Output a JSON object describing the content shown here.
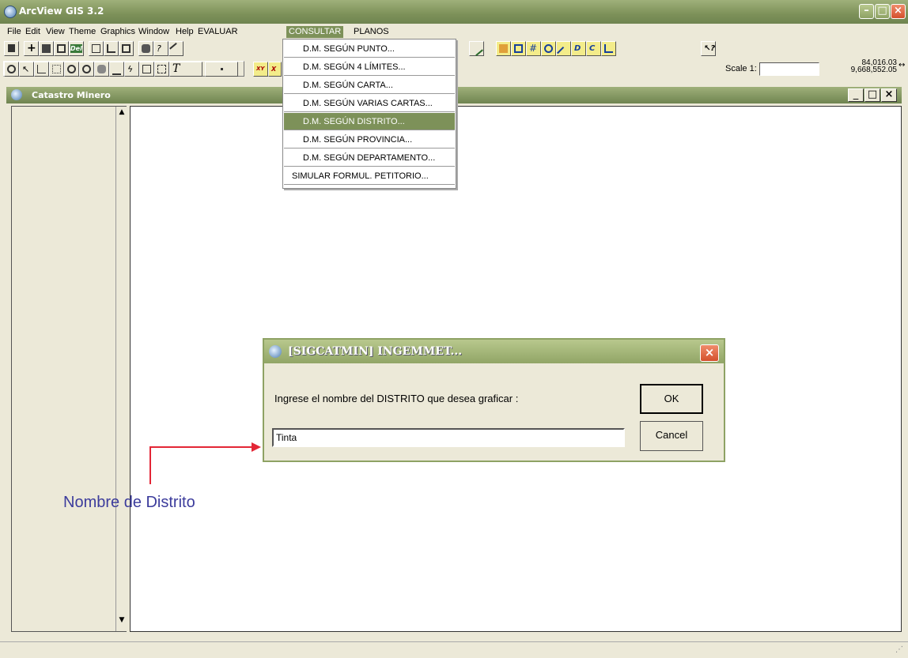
{
  "app": {
    "title": "ArcView GIS 3.2"
  },
  "menu": [
    "File",
    "Edit",
    "View",
    "Theme",
    "Graphics",
    "Window",
    "Help",
    "EVALUAR",
    "CONSULTAR",
    "PLANOS"
  ],
  "scale": {
    "label": "Scale 1:",
    "value": ""
  },
  "coords": {
    "x": "84,016.03",
    "y": "9,668,552.05"
  },
  "dropdown": {
    "items": [
      "D.M. SEGÚN PUNTO...",
      "D.M. SEGÚN 4 LÍMITES...",
      "D.M. SEGÚN CARTA...",
      "D.M. SEGÚN VARIAS CARTAS...",
      "D.M. SEGÚN DISTRITO...",
      "D.M. SEGÚN PROVINCIA...",
      "D.M. SEGÚN DEPARTAMENTO...",
      "SIMULAR FORMUL. PETITORIO..."
    ],
    "highlighted_index": 4
  },
  "view": {
    "title": "Catastro Minero"
  },
  "dialog": {
    "title": "[SIGCATMIN] INGEMMET...",
    "prompt": "Ingrese el nombre del DISTRITO que desea graficar :",
    "input_value": "Tinta",
    "ok_label": "OK",
    "cancel_label": "Cancel"
  },
  "annotation": {
    "text": "Nombre de Distrito",
    "arrow_color": "#e32636"
  },
  "colors": {
    "title_bar": "#7d9159",
    "menu_highlight": "#7d9159",
    "annotation_text": "#3c3c9c"
  }
}
